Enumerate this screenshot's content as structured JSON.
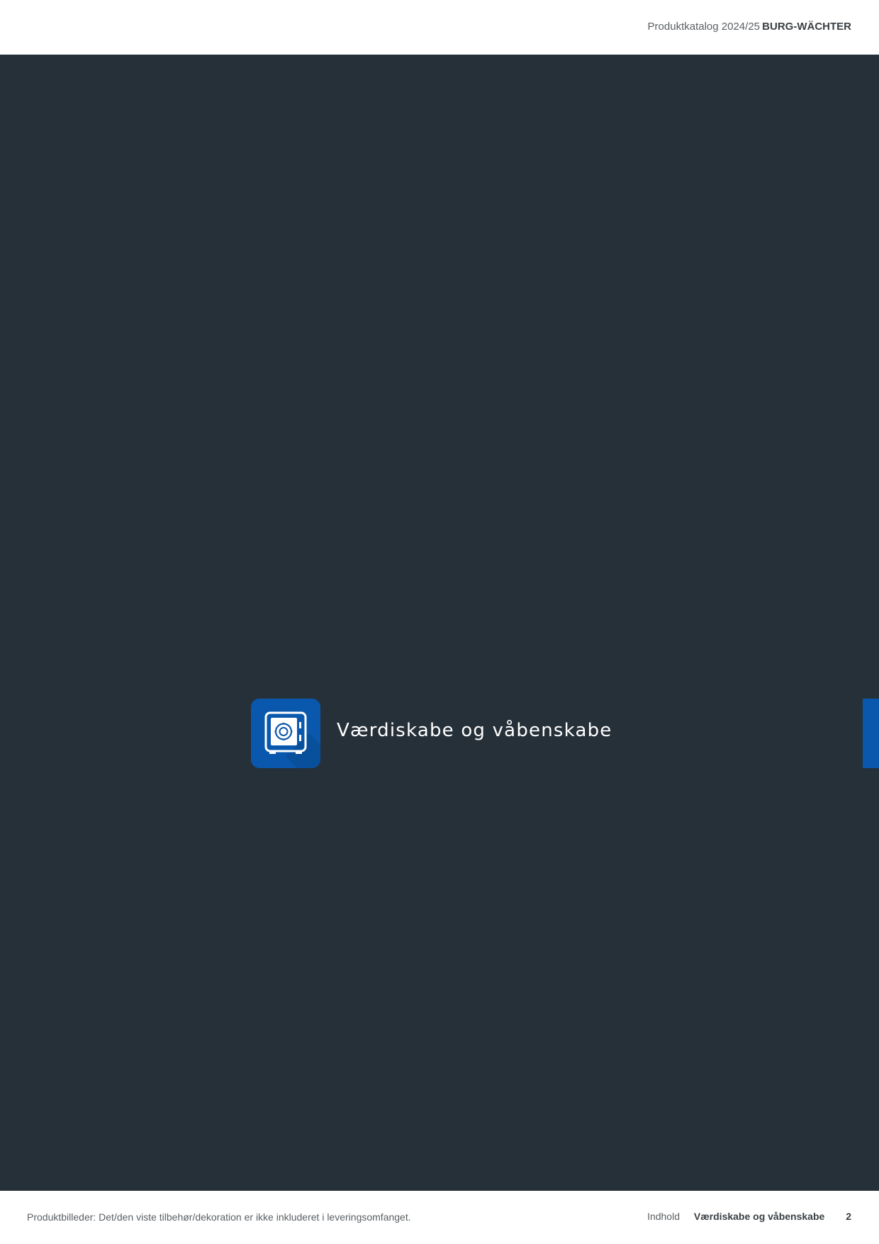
{
  "header": {
    "catalog_label": "Produktkatalog 2024/25",
    "brand": "BURG-WÄCHTER"
  },
  "section": {
    "title": "Værdiskabe og våbenskabe",
    "icon": "safe-icon"
  },
  "footer": {
    "note": "Produktbilleder: Det/den viste tilbehør/dekoration er ikke inkluderet i leveringsomfanget.",
    "nav_contents": "Indhold",
    "nav_section": "Værdiskabe og våbenskabe",
    "page_number": "2"
  },
  "colors": {
    "panel": "#263038",
    "accent": "#0a58ad",
    "text_light": "#ffffff",
    "text_muted": "#5a5f63"
  }
}
